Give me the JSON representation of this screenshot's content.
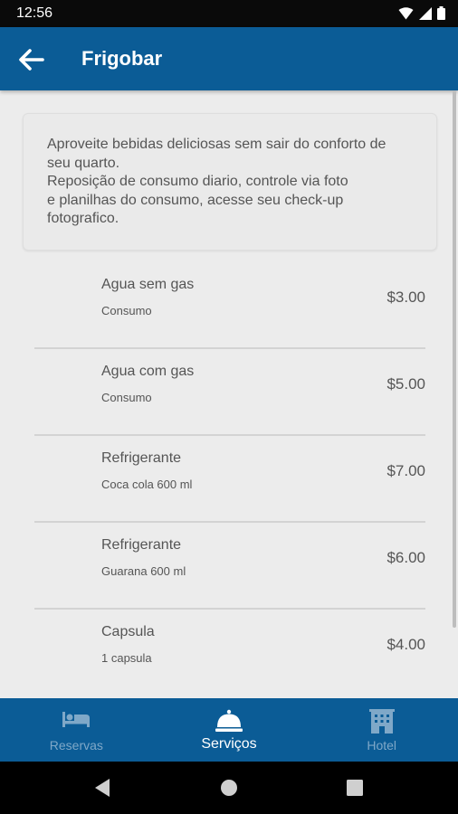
{
  "status_bar": {
    "time": "12:56"
  },
  "app_bar": {
    "title": "Frigobar"
  },
  "description": "Aproveite bebidas deliciosas sem sair do conforto de\nseu quarto.\nReposição de consumo diario, controle via foto\ne planilhas do consumo, acesse seu check-up\nfotografico.",
  "items": [
    {
      "name": "Agua sem gas",
      "sub": "Consumo",
      "price": "$3.00"
    },
    {
      "name": "Agua com gas",
      "sub": "Consumo",
      "price": "$5.00"
    },
    {
      "name": "Refrigerante",
      "sub": "Coca cola 600 ml",
      "price": "$7.00"
    },
    {
      "name": "Refrigerante",
      "sub": "Guarana 600 ml",
      "price": "$6.00"
    },
    {
      "name": "Capsula",
      "sub": "1 capsula",
      "price": "$4.00"
    }
  ],
  "bottom_nav": [
    {
      "label": "Reservas",
      "icon": "bed-icon",
      "active": false
    },
    {
      "label": "Serviços",
      "icon": "service-bell-icon",
      "active": true
    },
    {
      "label": "Hotel",
      "icon": "hotel-building-icon",
      "active": false
    }
  ],
  "colors": {
    "primary": "#0b5c96",
    "inactive_nav": "#7fa8c8"
  }
}
